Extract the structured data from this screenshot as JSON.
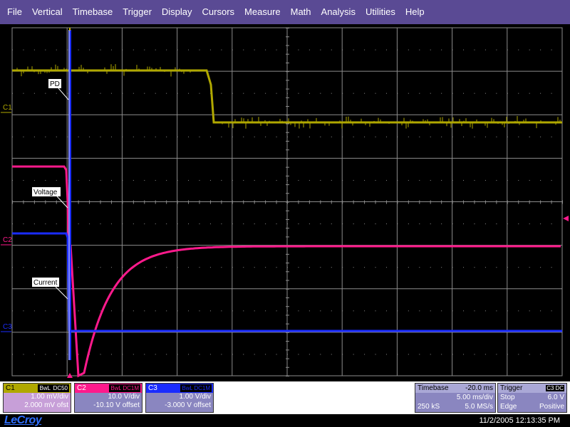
{
  "menu": [
    "File",
    "Vertical",
    "Timebase",
    "Trigger",
    "Display",
    "Cursors",
    "Measure",
    "Math",
    "Analysis",
    "Utilities",
    "Help"
  ],
  "colors": {
    "c1": "#b0a800",
    "c2": "#ff1a8c",
    "c3": "#1a2cff",
    "grid": "#8c8c8c",
    "menubar": "#5a4a94"
  },
  "traces": {
    "c1_label": "C1",
    "c2_label": "C2",
    "c3_label": "C3",
    "annotations": {
      "pd": "PD",
      "voltage": "Voltage",
      "current": "Current"
    }
  },
  "channels": [
    {
      "name": "C1",
      "coupling": "DC50",
      "bwl": "BwL",
      "vdiv": "1.00 mV/div",
      "offset": "2.000 mV ofst"
    },
    {
      "name": "C2",
      "coupling": "DC1M",
      "bwl": "BwL",
      "vdiv": "10.0 V/div",
      "offset": "-10.10 V offset"
    },
    {
      "name": "C3",
      "coupling": "DC1M",
      "bwl": "BwL",
      "vdiv": "1.00 V/div",
      "offset": "-3.000 V offset"
    }
  ],
  "timebase": {
    "title": "Timebase",
    "delay": "-20.0 ms",
    "tdiv": "5.00 ms/div",
    "samples": "250 kS",
    "rate": "5.0 MS/s"
  },
  "trigger": {
    "title": "Trigger",
    "source": "C3",
    "coupling": "DC",
    "mode": "Stop",
    "level": "6.0 V",
    "type": "Edge",
    "slope": "Positive"
  },
  "footer": {
    "logo": "LeCroy",
    "datetime": "11/2/2005 12:13:35 PM"
  }
}
